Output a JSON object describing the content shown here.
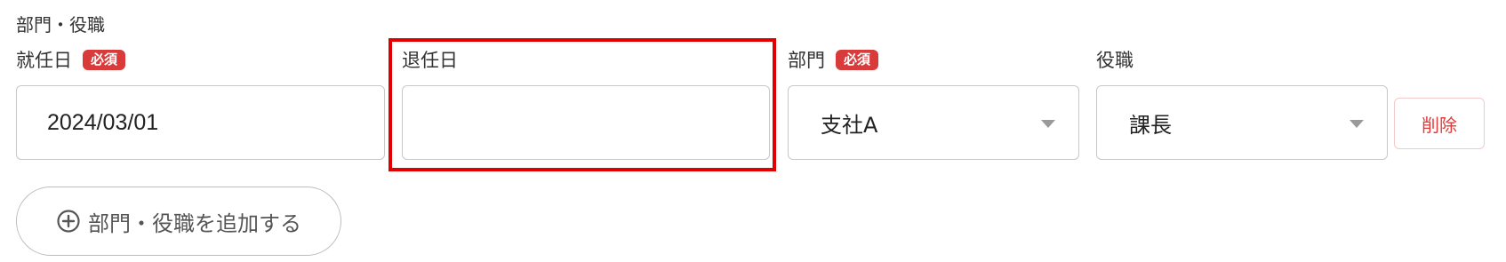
{
  "section": {
    "title": "部門・役職"
  },
  "fields": {
    "start_date": {
      "label": "就任日",
      "required_badge": "必須",
      "value": "2024/03/01"
    },
    "end_date": {
      "label": "退任日",
      "value": ""
    },
    "department": {
      "label": "部門",
      "required_badge": "必須",
      "selected": "支社A"
    },
    "position": {
      "label": "役職",
      "selected": "課長"
    }
  },
  "actions": {
    "delete_label": "削除",
    "add_label": "部門・役職を追加する"
  },
  "colors": {
    "required_badge": "#d93a3a",
    "highlight": "#e00000",
    "delete_text": "#e03a3a"
  },
  "icons": {
    "add": "plus-circle-icon",
    "dropdown": "chevron-down-icon"
  }
}
